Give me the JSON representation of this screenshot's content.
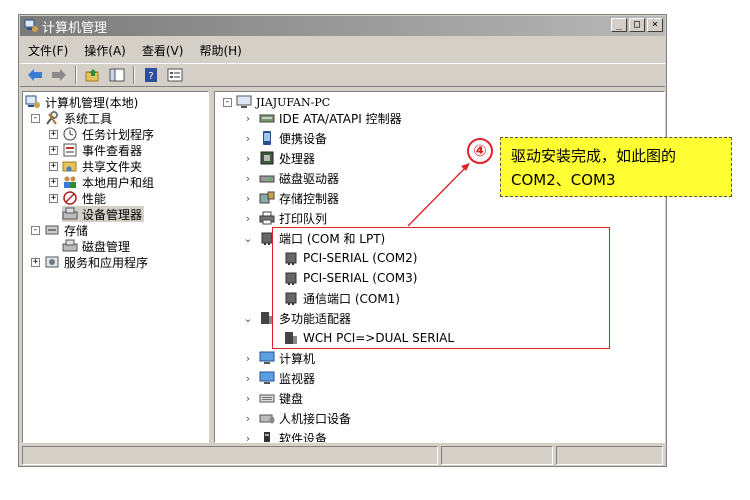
{
  "window": {
    "title": "计算机管理"
  },
  "menu": [
    "文件(F)",
    "操作(A)",
    "查看(V)",
    "帮助(H)"
  ],
  "title_buttons": {
    "minimize": "_",
    "maximize": "□",
    "close": "×"
  },
  "left_tree": [
    {
      "label": "计算机管理(本地)",
      "icon": "computer-management-icon"
    },
    {
      "label": "系统工具",
      "icon": "tools-icon"
    },
    {
      "label": "任务计划程序",
      "icon": "clock-icon"
    },
    {
      "label": "事件查看器",
      "icon": "event-viewer-icon"
    },
    {
      "label": "共享文件夹",
      "icon": "shared-folder-icon"
    },
    {
      "label": "本地用户和组",
      "icon": "users-icon"
    },
    {
      "label": "性能",
      "icon": "performance-icon"
    },
    {
      "label": "设备管理器",
      "icon": "device-manager-icon"
    },
    {
      "label": "存储",
      "icon": "storage-icon"
    },
    {
      "label": "磁盘管理",
      "icon": "disk-management-icon"
    },
    {
      "label": "服务和应用程序",
      "icon": "services-icon"
    }
  ],
  "devices": {
    "root": "JIAJUFAN-PC",
    "items": [
      {
        "label": "IDE ATA/ATAPI 控制器",
        "icon": "ide-controller-icon"
      },
      {
        "label": "便携设备",
        "icon": "portable-device-icon"
      },
      {
        "label": "处理器",
        "icon": "processor-icon"
      },
      {
        "label": "磁盘驱动器",
        "icon": "disk-drive-icon"
      },
      {
        "label": "存储控制器",
        "icon": "storage-controller-icon"
      },
      {
        "label": "打印队列",
        "icon": "printer-icon"
      },
      {
        "label": "端口 (COM 和 LPT)",
        "icon": "port-icon"
      },
      {
        "label": "PCI-SERIAL (COM2)",
        "icon": "port-icon"
      },
      {
        "label": "PCI-SERIAL (COM3)",
        "icon": "port-icon"
      },
      {
        "label": "通信端口 (COM1)",
        "icon": "port-icon"
      },
      {
        "label": "多功能适配器",
        "icon": "adapter-icon"
      },
      {
        "label": "WCH PCI=>DUAL SERIAL",
        "icon": "adapter-icon"
      },
      {
        "label": "计算机",
        "icon": "computer-icon"
      },
      {
        "label": "监视器",
        "icon": "monitor-icon"
      },
      {
        "label": "键盘",
        "icon": "keyboard-icon"
      },
      {
        "label": "人机接口设备",
        "icon": "hid-icon"
      },
      {
        "label": "软件设备",
        "icon": "software-device-icon"
      }
    ]
  },
  "annotation": {
    "step": "④",
    "line1": "驱动安装完成，如此图的",
    "line2": "COM2、COM3",
    "highlight_color": "#e0202a",
    "note_color": "#ffff33"
  }
}
